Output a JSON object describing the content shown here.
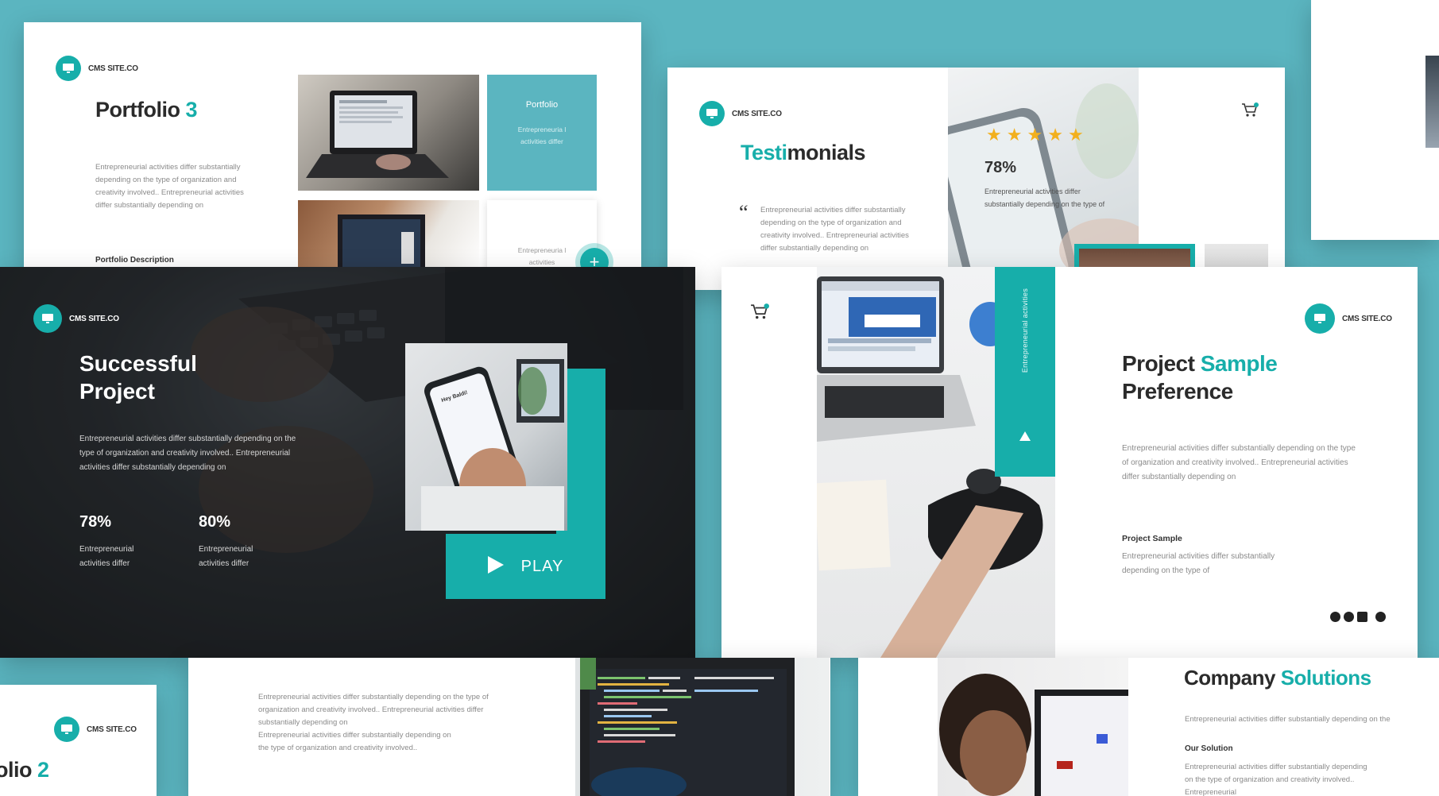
{
  "brand": {
    "name": "CMS SITE.CO"
  },
  "colors": {
    "accent": "#17aeaa",
    "background": "#5bb5c0",
    "dark": "#1c1f22"
  },
  "portfolio3": {
    "title_a": "Portfolio",
    "title_b": "3",
    "body": "Entrepreneurial activities differ substantially depending on the type of organization and creativity involved.. Entrepreneurial activities differ substantially depending on",
    "subheading": "Portfolio Description",
    "card_title": "Portfolio",
    "card_text": "Entrepreneuria l activities differ",
    "card2_text": "Entrepreneuria l activities"
  },
  "testimonials": {
    "title_a": "Testi",
    "title_b": "monials",
    "quote_mark": "“",
    "body": "Entrepreneurial activities differ substantially depending on the type of organization and creativity involved.. Entrepreneurial activities differ substantially depending on",
    "stat": "78%",
    "stat_text": "Entrepreneurial activities differ substantially depending on the type of",
    "stars": [
      "★",
      "★",
      "★",
      "★",
      "★"
    ],
    "rating": 5
  },
  "successful": {
    "title_line1": "Successful",
    "title_line2": "Project",
    "body": "Entrepreneurial activities differ substantially depending on the type of organization and creativity involved.. Entrepreneurial activities differ substantially depending on",
    "stats": [
      {
        "value": "78%",
        "label": "Entrepreneurial activities differ"
      },
      {
        "value": "80%",
        "label": "Entrepreneurial activities differ"
      }
    ],
    "play_label": "PLAY",
    "phone_greeting": "Hey Baldi!"
  },
  "project_sample": {
    "title_a": "Project",
    "title_b": "Sample",
    "title_line2": "Preference",
    "body": "Entrepreneurial activities differ substantially depending on the type of organization and creativity involved.. Entrepreneurial activities differ substantially depending on",
    "subheading": "Project Sample",
    "sub_body": "Entrepreneurial activities differ substantially depending on the type of",
    "vertical_label": "Entrepreneurial activities",
    "social_icons": [
      "twitter-icon",
      "facebook-icon",
      "linkedin-icon",
      "instagram-icon"
    ]
  },
  "bottom_left": {
    "title_a": "olio",
    "title_b": "2"
  },
  "bottom_mid": {
    "para1": "Entrepreneurial activities differ substantially depending on the type of organization and creativity involved.. Entrepreneurial activities differ substantially depending on",
    "para2": "Entrepreneurial activities differ substantially depending on the type of organization and creativity involved.."
  },
  "company": {
    "title_a": "Company",
    "title_b": "Solutions",
    "body": "Entrepreneurial activities differ substantially depending on the",
    "subheading": "Our Solution",
    "sub_body": "Entrepreneurial activities differ substantially depending on the type of organization and creativity involved.. Entrepreneurial"
  }
}
